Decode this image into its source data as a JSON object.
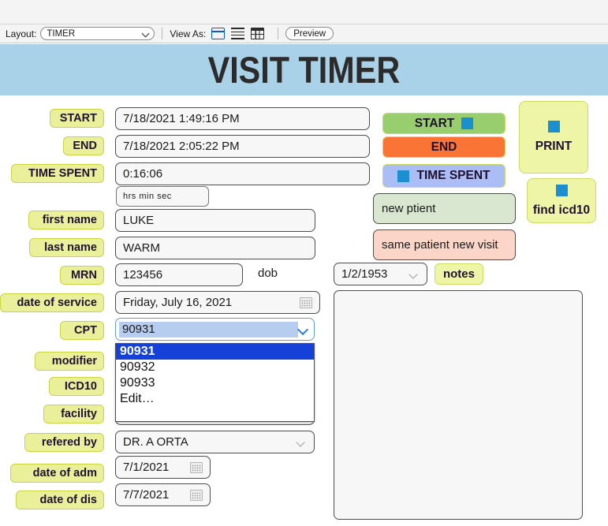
{
  "window": {
    "title": ""
  },
  "toolbar": {
    "layout_label": "Layout:",
    "layout_value": "TIMER",
    "layout_options": [
      "TIMER"
    ],
    "view_as_label": "View As:",
    "view_icons": [
      "form-view-icon",
      "list-view-icon",
      "table-view-icon"
    ],
    "preview_label": "Preview"
  },
  "banner": {
    "title": "VISIT TIMER"
  },
  "form": {
    "labels": {
      "start": "START",
      "end": "END",
      "time_spent": "TIME SPENT",
      "first_name": "first name",
      "last_name": "last name",
      "mrn": "MRN",
      "date_of_service": "date of service",
      "cpt": "CPT",
      "modifier": "modifier",
      "icd10": "ICD10",
      "facility": "facility",
      "refered_by": "refered by",
      "date_of_adm": "date of adm",
      "date_of_dis": "date of dis",
      "dob": "dob"
    },
    "values": {
      "start": "7/18/2021 1:49:16 PM",
      "end": "7/18/2021 2:05:22 PM",
      "time_spent": "0:16:06",
      "time_units_hint": "hrs min  sec",
      "first_name": "LUKE",
      "last_name": "WARM",
      "mrn": "123456",
      "date_of_service": "Friday, July 16, 2021",
      "cpt": "90931",
      "modifier": "",
      "icd10": "",
      "facility": "",
      "refered_by": "DR. A ORTA",
      "date_of_adm": "7/1/2021",
      "date_of_dis": "7/7/2021",
      "dob": "1/2/1953",
      "notes": ""
    },
    "cpt_dropdown": {
      "open": true,
      "options": [
        "90931",
        "90932",
        "90933",
        "Edit…"
      ],
      "selected_index": 0
    }
  },
  "actions": {
    "start": "START",
    "end": "END",
    "time_spent": "TIME SPENT",
    "print": "PRINT",
    "find_icd10": "find icd10",
    "new_patient": "new ptient",
    "same_patient_new_visit": "same patient new visit",
    "notes": "notes"
  },
  "colors": {
    "banner_bg": "#a9d2e8",
    "label_bg": "#eaf09a",
    "label_border": "#c9d440",
    "start_btn": "#98ce6d",
    "end_btn": "#fa7436",
    "time_btn": "#aabdf5",
    "accent_square": "#1b8fd0",
    "new_patient_bg": "#d9e7d1",
    "same_patient_bg": "#fad5c8",
    "dropdown_highlight": "#1541d8",
    "text_selection": "#b7cdef"
  }
}
